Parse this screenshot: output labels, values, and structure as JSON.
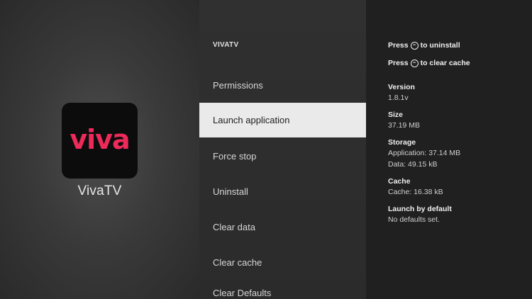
{
  "app": {
    "logo_text": "viva",
    "name": "VivaTV"
  },
  "menu": {
    "title": "VIVATV",
    "items": [
      {
        "label": "Permissions",
        "selected": false
      },
      {
        "label": "Launch application",
        "selected": true
      },
      {
        "label": "Force stop",
        "selected": false
      },
      {
        "label": "Uninstall",
        "selected": false
      },
      {
        "label": "Clear data",
        "selected": false
      },
      {
        "label": "Clear cache",
        "selected": false
      },
      {
        "label": "Clear Defaults",
        "selected": false
      }
    ]
  },
  "info": {
    "hints": [
      {
        "prefix": "Press",
        "icon": "menu-button-icon",
        "suffix": "to uninstall"
      },
      {
        "prefix": "Press",
        "icon": "menu-button-icon",
        "suffix": "to clear cache"
      }
    ],
    "version": {
      "label": "Version",
      "value": "1.8.1v"
    },
    "size": {
      "label": "Size",
      "value": "37.19 MB"
    },
    "storage": {
      "label": "Storage",
      "application": "Application: 37.14 MB",
      "data": "Data: 49.15 kB"
    },
    "cache": {
      "label": "Cache",
      "value": "Cache: 16.38 kB"
    },
    "launch_default": {
      "label": "Launch by default",
      "value": "No defaults set."
    }
  },
  "colors": {
    "logo_accent": "#ee2a5a",
    "selected_bg": "#eaeaea",
    "info_bg": "#202020"
  }
}
